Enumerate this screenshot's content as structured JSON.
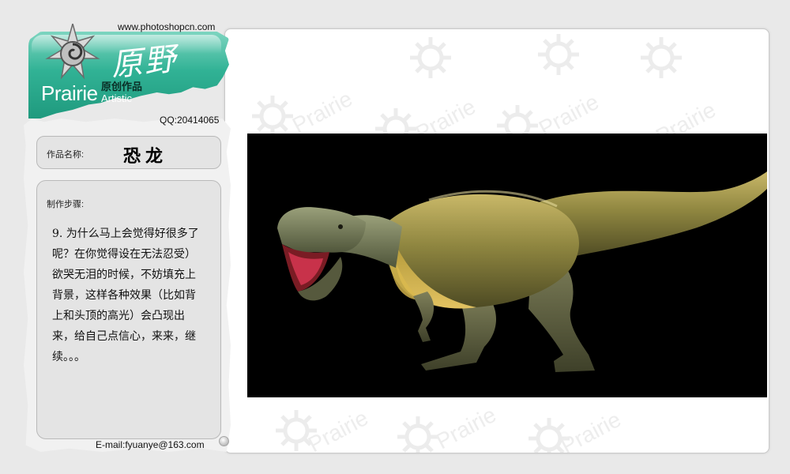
{
  "header": {
    "url": "www.photoshopcn.com",
    "brand": "Prairie",
    "tagline_cn": "原创作品",
    "tagline_en": "Artistic",
    "script_title": "原野",
    "qq": "QQ:20414065"
  },
  "work": {
    "name_label": "作品名称:",
    "name": "恐龙",
    "steps_label": "制作步骤:",
    "steps_text": "9. 为什么马上会觉得好很多了呢？在你觉得设在无法忍受）欲哭无泪的时候，不妨填充上背景，这样各种效果（比如背上和头顶的高光）会凸现出来，给自己点信心，来来，继续。。。"
  },
  "footer": {
    "email": "E-mail:fyuanye@163.com"
  },
  "watermark": {
    "text": "Prairie"
  },
  "artwork": {
    "subject": "dinosaur",
    "background_color": "#000000"
  },
  "colors": {
    "header_green": "#31b295",
    "panel_bg": "#e4e4e4",
    "page_bg": "#e9e9e9"
  }
}
